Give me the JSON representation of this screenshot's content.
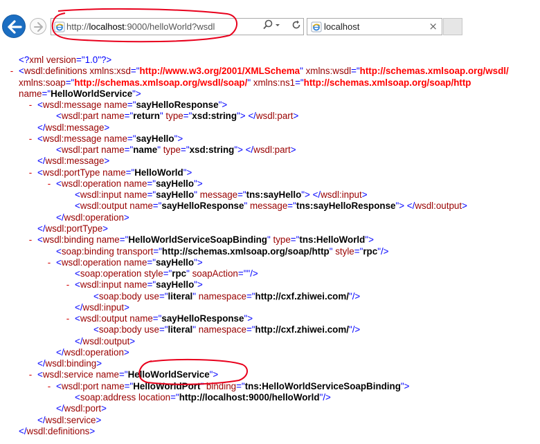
{
  "browser": {
    "address_scheme": "http://",
    "address_host": "localhost",
    "address_rest": ":9000/helloWorld?wsdl",
    "tab_title": "localhost",
    "tab_close_glyph": "×",
    "icons": [
      "back-arrow-icon",
      "forward-arrow-icon",
      "ie-page-icon",
      "search-icon",
      "dropdown-icon",
      "refresh-icon",
      "close-icon"
    ]
  },
  "xml_lines": [
    {
      "indent": 0,
      "collapse": "",
      "tokens": [
        [
          "b",
          "<?"
        ],
        [
          "r",
          "xml version"
        ],
        [
          "b",
          "=\""
        ],
        [
          "b",
          "1.0"
        ],
        [
          "b",
          "\"?>"
        ]
      ]
    },
    {
      "indent": 0,
      "collapse": "-",
      "tokens": [
        [
          "b",
          "<"
        ],
        [
          "r",
          "wsdl:definitions "
        ],
        [
          "r",
          "xmlns:xsd"
        ],
        [
          "b",
          "=\""
        ],
        [
          "rv",
          "http://www.w3.org/2001/XMLSchema"
        ],
        [
          "b",
          "\" "
        ],
        [
          "r",
          "xmlns:wsdl"
        ],
        [
          "b",
          "=\""
        ],
        [
          "rv",
          "http://schemas.xmlsoap.org/wsdl/"
        ]
      ]
    },
    {
      "indent": 0,
      "collapse": "",
      "tokens": [
        [
          "r",
          "xmlns:soap"
        ],
        [
          "b",
          "=\""
        ],
        [
          "rv",
          "http://schemas.xmlsoap.org/wsdl/soap/"
        ],
        [
          "b",
          "\" "
        ],
        [
          "r",
          "xmlns:ns1"
        ],
        [
          "b",
          "=\""
        ],
        [
          "rv",
          "http://schemas.xmlsoap.org/soap/http"
        ]
      ]
    },
    {
      "indent": 0,
      "collapse": "",
      "tokens": [
        [
          "r",
          "name"
        ],
        [
          "b",
          "=\""
        ],
        [
          "v",
          "HelloWorldService"
        ],
        [
          "b",
          "\">"
        ]
      ]
    },
    {
      "indent": 1,
      "collapse": "-",
      "tokens": [
        [
          "b",
          "<"
        ],
        [
          "r",
          "wsdl:message "
        ],
        [
          "r",
          "name"
        ],
        [
          "b",
          "=\""
        ],
        [
          "v",
          "sayHelloResponse"
        ],
        [
          "b",
          "\">"
        ]
      ]
    },
    {
      "indent": 2,
      "collapse": "",
      "tokens": [
        [
          "b",
          "<"
        ],
        [
          "r",
          "wsdl:part "
        ],
        [
          "r",
          "name"
        ],
        [
          "b",
          "=\""
        ],
        [
          "v",
          "return"
        ],
        [
          "b",
          "\" "
        ],
        [
          "r",
          "type"
        ],
        [
          "b",
          "=\""
        ],
        [
          "v",
          "xsd:string"
        ],
        [
          "b",
          "\"> </"
        ],
        [
          "r",
          "wsdl:part"
        ],
        [
          "b",
          ">"
        ]
      ]
    },
    {
      "indent": 1,
      "collapse": "",
      "tokens": [
        [
          "b",
          "</"
        ],
        [
          "r",
          "wsdl:message"
        ],
        [
          "b",
          ">"
        ]
      ]
    },
    {
      "indent": 1,
      "collapse": "-",
      "tokens": [
        [
          "b",
          "<"
        ],
        [
          "r",
          "wsdl:message "
        ],
        [
          "r",
          "name"
        ],
        [
          "b",
          "=\""
        ],
        [
          "v",
          "sayHello"
        ],
        [
          "b",
          "\">"
        ]
      ]
    },
    {
      "indent": 2,
      "collapse": "",
      "tokens": [
        [
          "b",
          "<"
        ],
        [
          "r",
          "wsdl:part "
        ],
        [
          "r",
          "name"
        ],
        [
          "b",
          "=\""
        ],
        [
          "v",
          "name"
        ],
        [
          "b",
          "\" "
        ],
        [
          "r",
          "type"
        ],
        [
          "b",
          "=\""
        ],
        [
          "v",
          "xsd:string"
        ],
        [
          "b",
          "\"> </"
        ],
        [
          "r",
          "wsdl:part"
        ],
        [
          "b",
          ">"
        ]
      ]
    },
    {
      "indent": 1,
      "collapse": "",
      "tokens": [
        [
          "b",
          "</"
        ],
        [
          "r",
          "wsdl:message"
        ],
        [
          "b",
          ">"
        ]
      ]
    },
    {
      "indent": 1,
      "collapse": "-",
      "tokens": [
        [
          "b",
          "<"
        ],
        [
          "r",
          "wsdl:portType "
        ],
        [
          "r",
          "name"
        ],
        [
          "b",
          "=\""
        ],
        [
          "v",
          "HelloWorld"
        ],
        [
          "b",
          "\">"
        ]
      ]
    },
    {
      "indent": 2,
      "collapse": "-",
      "tokens": [
        [
          "b",
          "<"
        ],
        [
          "r",
          "wsdl:operation "
        ],
        [
          "r",
          "name"
        ],
        [
          "b",
          "=\""
        ],
        [
          "v",
          "sayHello"
        ],
        [
          "b",
          "\">"
        ]
      ]
    },
    {
      "indent": 3,
      "collapse": "",
      "tokens": [
        [
          "b",
          "<"
        ],
        [
          "r",
          "wsdl:input "
        ],
        [
          "r",
          "name"
        ],
        [
          "b",
          "=\""
        ],
        [
          "v",
          "sayHello"
        ],
        [
          "b",
          "\" "
        ],
        [
          "r",
          "message"
        ],
        [
          "b",
          "=\""
        ],
        [
          "v",
          "tns:sayHello"
        ],
        [
          "b",
          "\"> </"
        ],
        [
          "r",
          "wsdl:input"
        ],
        [
          "b",
          ">"
        ]
      ]
    },
    {
      "indent": 3,
      "collapse": "",
      "tokens": [
        [
          "b",
          "<"
        ],
        [
          "r",
          "wsdl:output "
        ],
        [
          "r",
          "name"
        ],
        [
          "b",
          "=\""
        ],
        [
          "v",
          "sayHelloResponse"
        ],
        [
          "b",
          "\" "
        ],
        [
          "r",
          "message"
        ],
        [
          "b",
          "=\""
        ],
        [
          "v",
          "tns:sayHelloResponse"
        ],
        [
          "b",
          "\"> </"
        ],
        [
          "r",
          "wsdl:output"
        ],
        [
          "b",
          ">"
        ]
      ]
    },
    {
      "indent": 2,
      "collapse": "",
      "tokens": [
        [
          "b",
          "</"
        ],
        [
          "r",
          "wsdl:operation"
        ],
        [
          "b",
          ">"
        ]
      ]
    },
    {
      "indent": 1,
      "collapse": "",
      "tokens": [
        [
          "b",
          "</"
        ],
        [
          "r",
          "wsdl:portType"
        ],
        [
          "b",
          ">"
        ]
      ]
    },
    {
      "indent": 1,
      "collapse": "-",
      "tokens": [
        [
          "b",
          "<"
        ],
        [
          "r",
          "wsdl:binding "
        ],
        [
          "r",
          "name"
        ],
        [
          "b",
          "=\""
        ],
        [
          "v",
          "HelloWorldServiceSoapBinding"
        ],
        [
          "b",
          "\" "
        ],
        [
          "r",
          "type"
        ],
        [
          "b",
          "=\""
        ],
        [
          "v",
          "tns:HelloWorld"
        ],
        [
          "b",
          "\">"
        ]
      ]
    },
    {
      "indent": 2,
      "collapse": "",
      "tokens": [
        [
          "b",
          "<"
        ],
        [
          "r",
          "soap:binding "
        ],
        [
          "r",
          "transport"
        ],
        [
          "b",
          "=\""
        ],
        [
          "v",
          "http://schemas.xmlsoap.org/soap/http"
        ],
        [
          "b",
          "\" "
        ],
        [
          "r",
          "style"
        ],
        [
          "b",
          "=\""
        ],
        [
          "v",
          "rpc"
        ],
        [
          "b",
          "\"/>"
        ]
      ]
    },
    {
      "indent": 2,
      "collapse": "-",
      "tokens": [
        [
          "b",
          "<"
        ],
        [
          "r",
          "wsdl:operation "
        ],
        [
          "r",
          "name"
        ],
        [
          "b",
          "=\""
        ],
        [
          "v",
          "sayHello"
        ],
        [
          "b",
          "\">"
        ]
      ]
    },
    {
      "indent": 3,
      "collapse": "",
      "tokens": [
        [
          "b",
          "<"
        ],
        [
          "r",
          "soap:operation "
        ],
        [
          "r",
          "style"
        ],
        [
          "b",
          "=\""
        ],
        [
          "v",
          "rpc"
        ],
        [
          "b",
          "\" "
        ],
        [
          "r",
          "soapAction"
        ],
        [
          "b",
          "=\"\"/>"
        ]
      ]
    },
    {
      "indent": 3,
      "collapse": "-",
      "tokens": [
        [
          "b",
          "<"
        ],
        [
          "r",
          "wsdl:input "
        ],
        [
          "r",
          "name"
        ],
        [
          "b",
          "=\""
        ],
        [
          "v",
          "sayHello"
        ],
        [
          "b",
          "\">"
        ]
      ]
    },
    {
      "indent": 4,
      "collapse": "",
      "tokens": [
        [
          "b",
          "<"
        ],
        [
          "r",
          "soap:body "
        ],
        [
          "r",
          "use"
        ],
        [
          "b",
          "=\""
        ],
        [
          "v",
          "literal"
        ],
        [
          "b",
          "\" "
        ],
        [
          "r",
          "namespace"
        ],
        [
          "b",
          "=\""
        ],
        [
          "v",
          "http://cxf.zhiwei.com/"
        ],
        [
          "b",
          "\"/>"
        ]
      ]
    },
    {
      "indent": 3,
      "collapse": "",
      "tokens": [
        [
          "b",
          "</"
        ],
        [
          "r",
          "wsdl:input"
        ],
        [
          "b",
          ">"
        ]
      ]
    },
    {
      "indent": 3,
      "collapse": "-",
      "tokens": [
        [
          "b",
          "<"
        ],
        [
          "r",
          "wsdl:output "
        ],
        [
          "r",
          "name"
        ],
        [
          "b",
          "=\""
        ],
        [
          "v",
          "sayHelloResponse"
        ],
        [
          "b",
          "\">"
        ]
      ]
    },
    {
      "indent": 4,
      "collapse": "",
      "tokens": [
        [
          "b",
          "<"
        ],
        [
          "r",
          "soap:body "
        ],
        [
          "r",
          "use"
        ],
        [
          "b",
          "=\""
        ],
        [
          "v",
          "literal"
        ],
        [
          "b",
          "\" "
        ],
        [
          "r",
          "namespace"
        ],
        [
          "b",
          "=\""
        ],
        [
          "v",
          "http://cxf.zhiwei.com/"
        ],
        [
          "b",
          "\"/>"
        ]
      ]
    },
    {
      "indent": 3,
      "collapse": "",
      "tokens": [
        [
          "b",
          "</"
        ],
        [
          "r",
          "wsdl:output"
        ],
        [
          "b",
          ">"
        ]
      ]
    },
    {
      "indent": 2,
      "collapse": "",
      "tokens": [
        [
          "b",
          "</"
        ],
        [
          "r",
          "wsdl:operation"
        ],
        [
          "b",
          ">"
        ]
      ]
    },
    {
      "indent": 1,
      "collapse": "",
      "tokens": [
        [
          "b",
          "</"
        ],
        [
          "r",
          "wsdl:binding"
        ],
        [
          "b",
          ">"
        ]
      ]
    },
    {
      "indent": 1,
      "collapse": "-",
      "tokens": [
        [
          "b",
          "<"
        ],
        [
          "r",
          "wsdl:service "
        ],
        [
          "r",
          "name"
        ],
        [
          "b",
          "=\""
        ],
        [
          "v",
          "HelloWorldService"
        ],
        [
          "b",
          "\">"
        ]
      ]
    },
    {
      "indent": 2,
      "collapse": "-",
      "tokens": [
        [
          "b",
          "<"
        ],
        [
          "r",
          "wsdl:port "
        ],
        [
          "r",
          "name"
        ],
        [
          "b",
          "=\""
        ],
        [
          "v",
          "HelloWorldPort"
        ],
        [
          "b",
          "\" "
        ],
        [
          "r",
          "binding"
        ],
        [
          "b",
          "=\""
        ],
        [
          "v",
          "tns:HelloWorldServiceSoapBinding"
        ],
        [
          "b",
          "\">"
        ]
      ]
    },
    {
      "indent": 3,
      "collapse": "",
      "tokens": [
        [
          "b",
          "<"
        ],
        [
          "r",
          "soap:address "
        ],
        [
          "r",
          "location"
        ],
        [
          "b",
          "=\""
        ],
        [
          "v",
          "http://localhost:9000/helloWorld"
        ],
        [
          "b",
          "\"/>"
        ]
      ]
    },
    {
      "indent": 2,
      "collapse": "",
      "tokens": [
        [
          "b",
          "</"
        ],
        [
          "r",
          "wsdl:port"
        ],
        [
          "b",
          ">"
        ]
      ]
    },
    {
      "indent": 1,
      "collapse": "",
      "tokens": [
        [
          "b",
          "</"
        ],
        [
          "r",
          "wsdl:service"
        ],
        [
          "b",
          ">"
        ]
      ]
    },
    {
      "indent": 0,
      "collapse": "",
      "tokens": [
        [
          "b",
          "</"
        ],
        [
          "r",
          "wsdl:definitions"
        ],
        [
          "b",
          ">"
        ]
      ]
    }
  ],
  "colors": {
    "tag_blue": "#0000ff",
    "name_red": "#990000",
    "value_black": "#000000",
    "ns_value_red": "#ff0000",
    "collapse_red": "#d40000",
    "annotation_red": "#e8001c",
    "back_button_blue": "#1b6ec2"
  }
}
